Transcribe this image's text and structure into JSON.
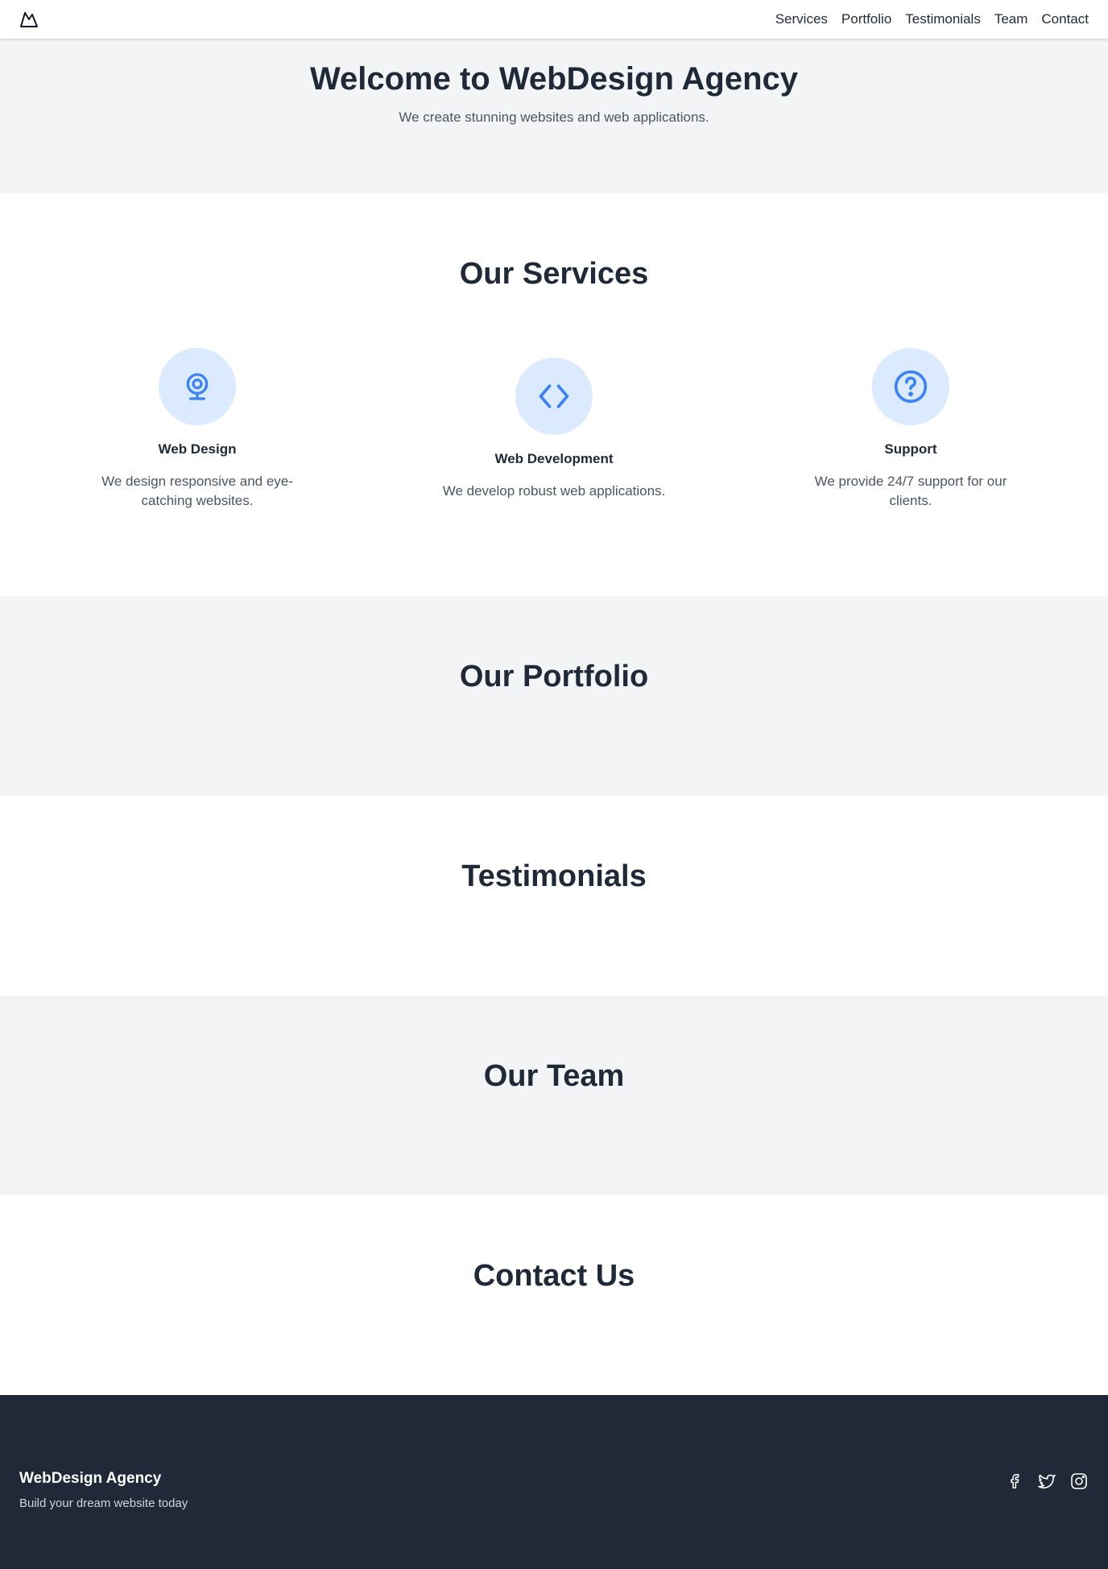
{
  "nav": {
    "logo_icon": "mountain-logo-icon",
    "links": [
      "Services",
      "Portfolio",
      "Testimonials",
      "Team",
      "Contact"
    ]
  },
  "hero": {
    "title": "Welcome to WebDesign Agency",
    "subtitle": "We create stunning websites and web applications."
  },
  "services": {
    "heading": "Our Services",
    "items": [
      {
        "icon": "webcam-icon",
        "title": "Web Design",
        "description": "We design responsive and eye-catching websites."
      },
      {
        "icon": "code-icon",
        "title": "Web Development",
        "description": "We develop robust web applications."
      },
      {
        "icon": "question-icon",
        "title": "Support",
        "description": "We provide 24/7 support for our clients."
      }
    ]
  },
  "portfolio": {
    "heading": "Our Portfolio"
  },
  "testimonials": {
    "heading": "Testimonials"
  },
  "team": {
    "heading": "Our Team"
  },
  "contact": {
    "heading": "Contact Us"
  },
  "footer": {
    "brand": "WebDesign Agency",
    "tagline": "Build your dream website today",
    "socials": [
      "facebook-icon",
      "twitter-icon",
      "instagram-icon"
    ]
  },
  "colors": {
    "accent": "#3b82f6",
    "icon_bg": "#dbeafe",
    "text_dark": "#1f2937",
    "section_gray": "#f3f4f6",
    "footer_bg": "#1f2937"
  }
}
